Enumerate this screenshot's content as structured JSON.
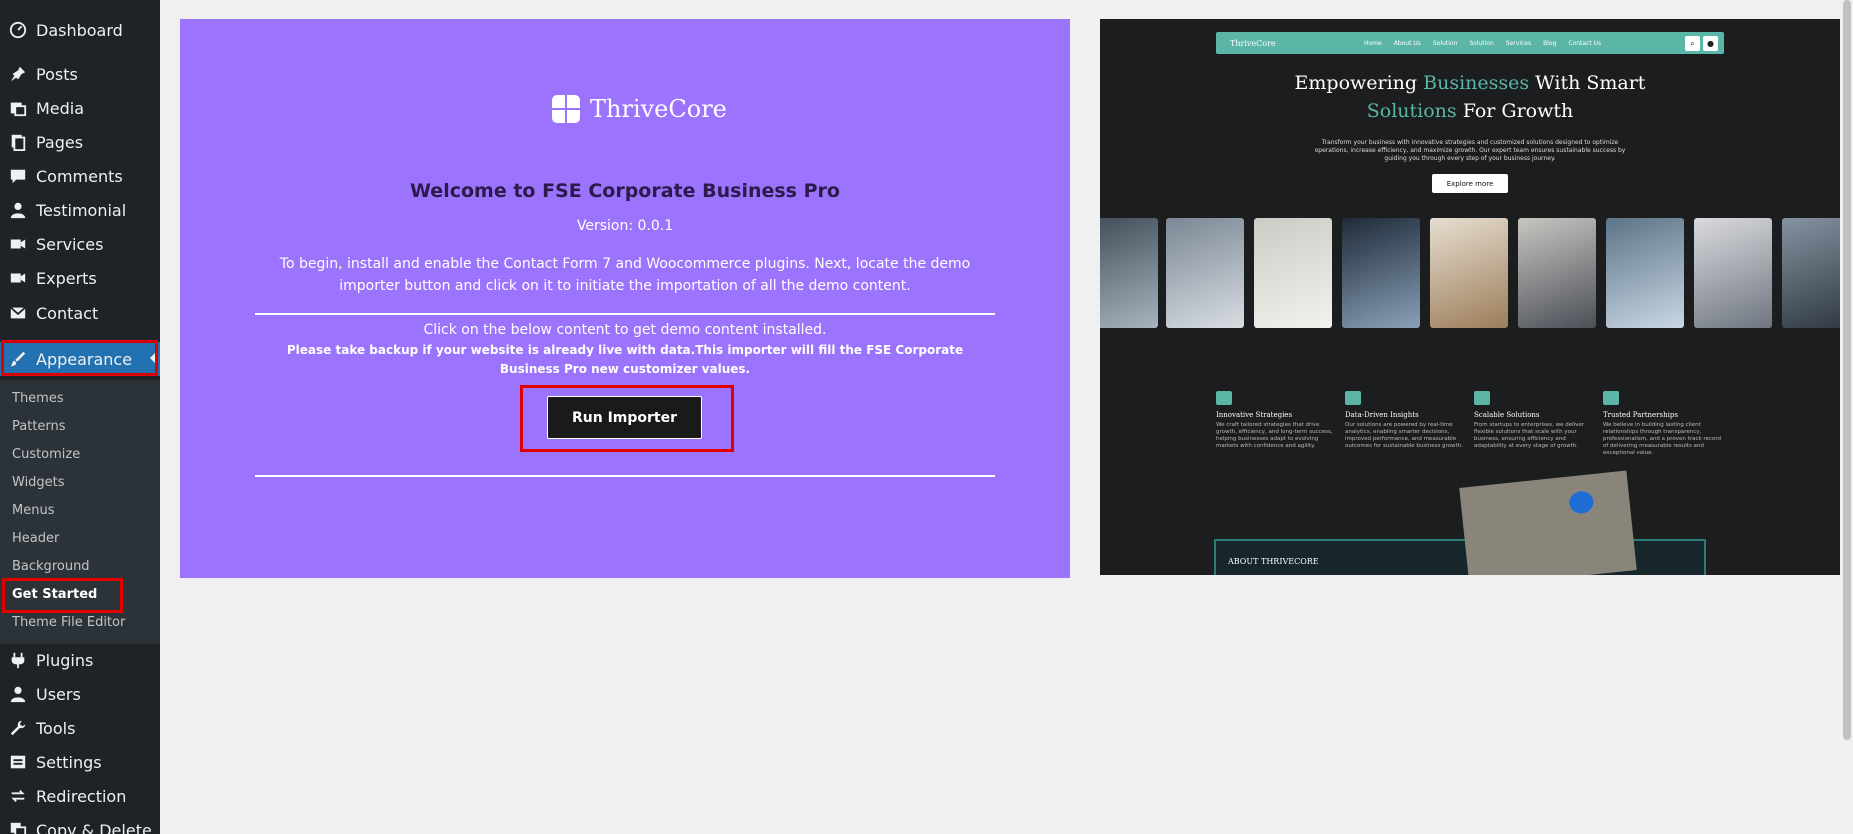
{
  "sidebar": {
    "items": [
      {
        "label": "Dashboard",
        "icon": "dashboard-icon"
      },
      {
        "label": "Posts",
        "icon": "pin-icon"
      },
      {
        "label": "Media",
        "icon": "media-icon"
      },
      {
        "label": "Pages",
        "icon": "pages-icon"
      },
      {
        "label": "Comments",
        "icon": "comment-icon"
      },
      {
        "label": "Testimonial",
        "icon": "user-icon"
      },
      {
        "label": "Services",
        "icon": "video-icon"
      },
      {
        "label": "Experts",
        "icon": "video-icon"
      },
      {
        "label": "Contact",
        "icon": "mail-icon"
      },
      {
        "label": "Appearance",
        "icon": "brush-icon"
      },
      {
        "label": "Plugins",
        "icon": "plugin-icon"
      },
      {
        "label": "Users",
        "icon": "user-icon"
      },
      {
        "label": "Tools",
        "icon": "wrench-icon"
      },
      {
        "label": "Settings",
        "icon": "settings-icon"
      },
      {
        "label": "Redirection",
        "icon": "redirect-icon"
      },
      {
        "label": "Copy & Delete",
        "icon": "copy-icon"
      }
    ],
    "submenu": [
      "Themes",
      "Patterns",
      "Customize",
      "Widgets",
      "Menus",
      "Header",
      "Background",
      "Get Started",
      "Theme File Editor"
    ]
  },
  "panel": {
    "brand": "ThriveCore",
    "title": "Welcome to FSE Corporate Business Pro",
    "version": "Version: 0.0.1",
    "description": "To begin, install and enable the Contact Form 7 and Woocommerce plugins. Next, locate the demo importer button and click on it to initiate the importation of all the demo content.",
    "click_text": "Click on the below content to get demo content installed.",
    "warning": "Please take backup if your website is already live with data.This importer will fill the FSE Corporate Business Pro new customizer values.",
    "button": "Run Importer"
  },
  "preview": {
    "brand": "ThriveCore",
    "nav": [
      "Home",
      "About Us",
      "Solution",
      "Solution",
      "Services",
      "Blog",
      "Contact Us"
    ],
    "hero_1a": "Empowering ",
    "hero_1b": "Businesses",
    "hero_1c": " With Smart",
    "hero_2a": "Solutions",
    "hero_2b": " For Growth",
    "hero_sub": "Transform your business with innovative strategies and customized solutions designed to optimize operations, increase efficiency, and maximize growth. Our expert team ensures sustainable success by guiding you through every step of your business journey.",
    "cta": "Explore more",
    "features": [
      {
        "title": "Innovative Strategies",
        "desc": "We craft tailored strategies that drive growth, efficiency, and long-term success, helping businesses adapt to evolving markets with confidence and agility."
      },
      {
        "title": "Data-Driven Insights",
        "desc": "Our solutions are powered by real-time analytics, enabling smarter decisions, improved performance, and measurable outcomes for sustainable business growth."
      },
      {
        "title": "Scalable Solutions",
        "desc": "From startups to enterprises, we deliver flexible solutions that scale with your business, ensuring efficiency and adaptability at every stage of growth."
      },
      {
        "title": "Trusted Partnerships",
        "desc": "We believe in building lasting client relationships through transparency, professionalism, and a proven track record of delivering measurable results and exceptional value."
      }
    ],
    "about": "ABOUT THRIVECORE"
  },
  "colors": {
    "panel_bg": "#9b73fd",
    "sidebar_bg": "#1d2327",
    "active": "#2271b1",
    "highlight": "#e00000",
    "accent": "#5bb6a8"
  }
}
